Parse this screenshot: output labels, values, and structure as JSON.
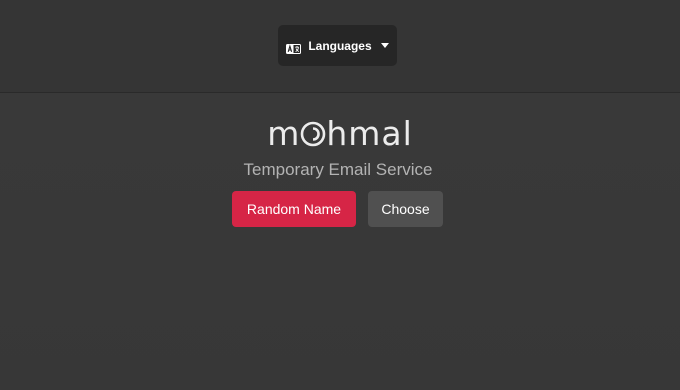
{
  "header": {
    "language_button_label": "Languages",
    "language_icon": "translate-icon",
    "dropdown_icon": "caret-down-icon"
  },
  "brand": {
    "logo_prefix": "m",
    "logo_suffix": "hmal",
    "logo_mark_icon": "mohmal-o-swirl-icon",
    "tagline": "Temporary Email Service"
  },
  "actions": {
    "random_name_label": "Random Name",
    "choose_label": "Choose"
  },
  "colors": {
    "background": "#383838",
    "primary_button": "#d62546",
    "secondary_button": "#505050",
    "language_button": "#262626"
  }
}
